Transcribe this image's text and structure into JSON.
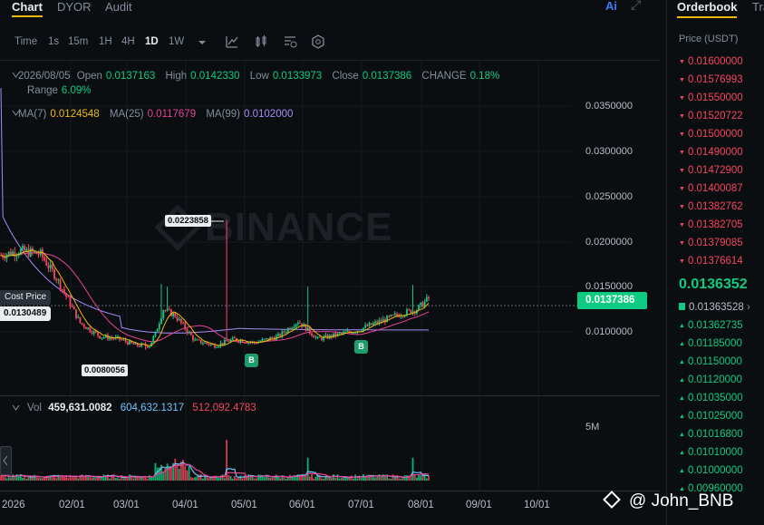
{
  "tabs": [
    {
      "label": "Chart"
    },
    {
      "label": "DYOR"
    },
    {
      "label": "Audit"
    }
  ],
  "ai_label": "Ai",
  "intervals": [
    "Time",
    "1s",
    "15m",
    "1H",
    "4H",
    "1D",
    "1W"
  ],
  "active_interval": "1D",
  "ohlc": {
    "date": "2026/08/05",
    "open_label": "Open",
    "open": "0.0137163",
    "high_label": "High",
    "high": "0.0142330",
    "low_label": "Low",
    "low": "0.0133973",
    "close_label": "Close",
    "close": "0.0137386",
    "change_label": "CHANGE",
    "change": "0.18%",
    "range_label": "Range",
    "range": "6.09%"
  },
  "ma": {
    "ma7_label": "MA(7)",
    "ma7": "0.0124548",
    "ma25_label": "MA(25)",
    "ma25": "0.0117679",
    "ma99_label": "MA(99)",
    "ma99": "0.0102000"
  },
  "volume": {
    "label": "Vol",
    "v1": "459,631.0082",
    "v2": "604,632.1317",
    "v3": "512,092.4783",
    "axis_label": "5M"
  },
  "y_axis": [
    "0.0350000",
    "0.0300000",
    "0.0250000",
    "0.0200000",
    "0.0150000",
    "0.0100000"
  ],
  "current_price_tag": "0.0137386",
  "cost_price_label": "Cost Price",
  "cost_price_value": "0.0130489",
  "high_marker": "0.0223858",
  "low_marker": "0.0080056",
  "buy_badge": "B",
  "watermark": "BINANCE",
  "x_axis": [
    "2026",
    "02/01",
    "03/01",
    "04/01",
    "05/01",
    "06/01",
    "07/01",
    "08/01",
    "09/01",
    "10/01"
  ],
  "orderbook": {
    "tab_active": "Orderbook",
    "tab_inactive": "Tra",
    "header": "Price (USDT)",
    "asks": [
      "0.01600000",
      "0.01576993",
      "0.01550000",
      "0.01520722",
      "0.01500000",
      "0.01490000",
      "0.01472900",
      "0.01400087",
      "0.01382762",
      "0.01382705",
      "0.01379085",
      "0.01376614"
    ],
    "last_price": "0.0136352",
    "ref_price": "0.01363528",
    "bids": [
      "0.01362735",
      "0.01185000",
      "0.01150000",
      "0.01120000",
      "0.01035000",
      "0.01025000",
      "0.01016800",
      "0.01010000",
      "0.01000000",
      "0.00960000"
    ]
  },
  "credit": "@ John_BNB",
  "colors": {
    "up": "#0ecb81",
    "down": "#f6465d",
    "ma7": "#f0b90b",
    "ma25": "#e84393",
    "ma99": "#a78bfa",
    "accent": "#f0b90b"
  }
}
